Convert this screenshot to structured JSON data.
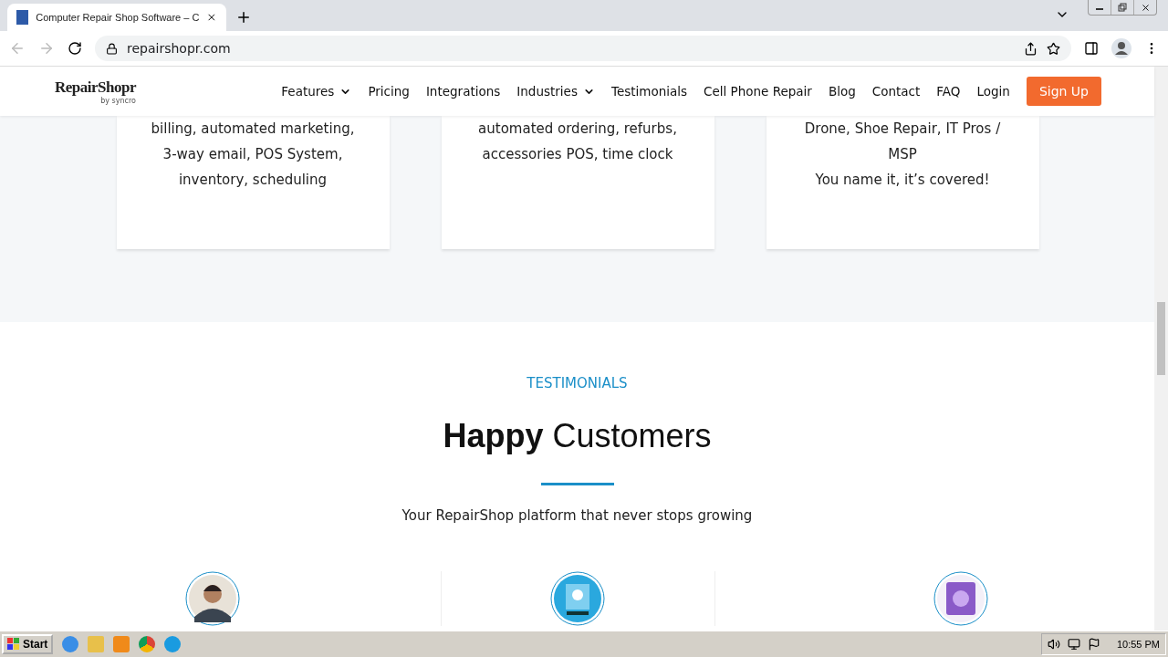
{
  "browser": {
    "tab_title": "Computer Repair Shop Software – C",
    "url": "repairshopr.com"
  },
  "nav": {
    "logo": "RepairShopr",
    "logo_sub": "by syncro",
    "items": [
      {
        "label": "Features",
        "dropdown": true
      },
      {
        "label": "Pricing",
        "dropdown": false
      },
      {
        "label": "Integrations",
        "dropdown": false
      },
      {
        "label": "Industries",
        "dropdown": true
      },
      {
        "label": "Testimonials",
        "dropdown": false
      },
      {
        "label": "Cell Phone Repair",
        "dropdown": false
      },
      {
        "label": "Blog",
        "dropdown": false
      },
      {
        "label": "Contact",
        "dropdown": false
      },
      {
        "label": "FAQ",
        "dropdown": false
      },
      {
        "label": "Login",
        "dropdown": false
      }
    ],
    "cta": "Sign Up"
  },
  "cards": [
    {
      "lines": [
        "billing, automated marketing,",
        "3-way email, POS System,",
        "inventory, scheduling"
      ]
    },
    {
      "lines": [
        "automated ordering, refurbs,",
        "accessories POS, time clock"
      ]
    },
    {
      "lines": [
        "Drone, Shoe Repair, IT Pros /",
        "MSP",
        "You name it, it’s covered!"
      ]
    }
  ],
  "testimonials": {
    "eyebrow": "TESTIMONIALS",
    "title": "**Happy** Customers",
    "subtitle": "Your RepairShop platform that never stops growing",
    "avatars": [
      {
        "kind": "person"
      },
      {
        "kind": "badge"
      },
      {
        "kind": "emblem"
      }
    ]
  },
  "taskbar": {
    "start": "Start",
    "clock": "10:55 PM"
  }
}
